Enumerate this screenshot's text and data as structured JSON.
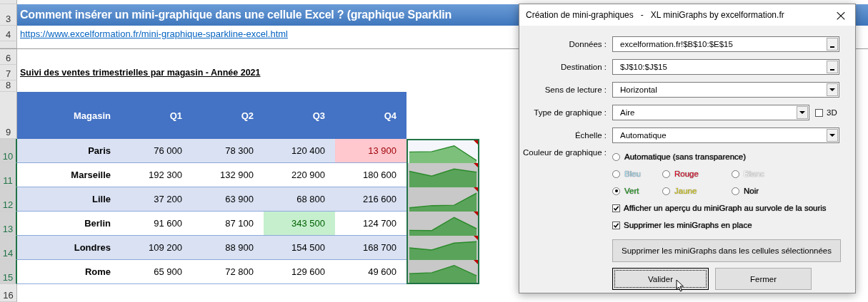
{
  "sheet": {
    "title": "Comment insérer un mini-graphique dans une cellule Excel ? (graphique Sparklin",
    "link": "https://www.excelformation.fr/mini-graphique-sparkline-excel.html",
    "subtitle": "Suivi des ventes trimestrielles par magasin - Année 2021",
    "row_numbers": {
      "title": "3",
      "link": "4",
      "blank_a": "6",
      "subtitle": "7",
      "blank_b": "8",
      "header": "9",
      "after": "16"
    },
    "table": {
      "columns": [
        "Magasin",
        "Q1",
        "Q2",
        "Q3",
        "Q4"
      ],
      "rows": [
        {
          "number": "10",
          "cells": [
            {
              "text": "Paris"
            },
            {
              "text": "76 000"
            },
            {
              "text": "78 300"
            },
            {
              "text": "120 400"
            },
            {
              "text": "13 900",
              "kind": "low"
            }
          ],
          "preview": true
        },
        {
          "number": "11",
          "cells": [
            {
              "text": "Marseille"
            },
            {
              "text": "192 300"
            },
            {
              "text": "132 900"
            },
            {
              "text": "220 900"
            },
            {
              "text": "180 600"
            }
          ],
          "preview": false
        },
        {
          "number": "12",
          "cells": [
            {
              "text": "Lille"
            },
            {
              "text": "37 200"
            },
            {
              "text": "63 900"
            },
            {
              "text": "68 800"
            },
            {
              "text": "216 600"
            }
          ],
          "preview": false
        },
        {
          "number": "13",
          "cells": [
            {
              "text": "Berlin"
            },
            {
              "text": "91 600"
            },
            {
              "text": "87 100"
            },
            {
              "text": "343 500",
              "kind": "high"
            },
            {
              "text": "124 700"
            }
          ],
          "preview": false
        },
        {
          "number": "14",
          "cells": [
            {
              "text": "Londres"
            },
            {
              "text": "109 200"
            },
            {
              "text": "88 900"
            },
            {
              "text": "154 500"
            },
            {
              "text": "168 700"
            }
          ],
          "preview": false
        },
        {
          "number": "15",
          "cells": [
            {
              "text": "Rome"
            },
            {
              "text": "65 900"
            },
            {
              "text": "72 800"
            },
            {
              "text": "129 600"
            },
            {
              "text": "49 600"
            }
          ],
          "preview": false
        }
      ]
    }
  },
  "dialog": {
    "title": "Création de mini-graphiques   -   XL miniGraphs by excelformation.fr",
    "close": "×",
    "fields": [
      {
        "kind": "range",
        "label": "Données :",
        "value": "excelformation.fr!$B$10:$E$15"
      },
      {
        "kind": "range",
        "label": "Destination :",
        "value": "$J$10:$J$15"
      },
      {
        "kind": "select",
        "label": "Sens de lecture :",
        "value": "Horizontal"
      },
      {
        "kind": "select3d",
        "label": "Type de graphique :",
        "value": "Aire",
        "option_label": "3D",
        "checked": false
      },
      {
        "kind": "select",
        "label": "Échelle :",
        "value": "Automatique"
      }
    ],
    "color_label": "Couleur de graphique :",
    "auto_option": {
      "label": "Automatique (sans transparence)",
      "selected": false
    },
    "color_options": [
      {
        "label": "Bleu",
        "color": "#9fd3e8",
        "selected": false
      },
      {
        "label": "Rouge",
        "color": "#e0102a",
        "selected": false
      },
      {
        "label": "Blanc",
        "color": "#ffffff",
        "selected": false
      },
      {
        "label": "Vert",
        "color": "#1f9a1f",
        "selected": true
      },
      {
        "label": "Jaune",
        "color": "#d4c816",
        "selected": false
      },
      {
        "label": "Noir",
        "color": "#000000",
        "selected": false
      }
    ],
    "checkboxes": [
      {
        "label": "Afficher un aperçu du miniGraph au survole de la souris",
        "checked": true
      },
      {
        "label": "Supprimer les miniGraphs en place",
        "checked": true
      }
    ],
    "delete_button": "Supprimer les miniGraphs dans les cellules sélectionnées",
    "buttons": [
      {
        "label": "Valider",
        "focused": true
      },
      {
        "label": "Fermer",
        "focused": false
      }
    ]
  }
}
